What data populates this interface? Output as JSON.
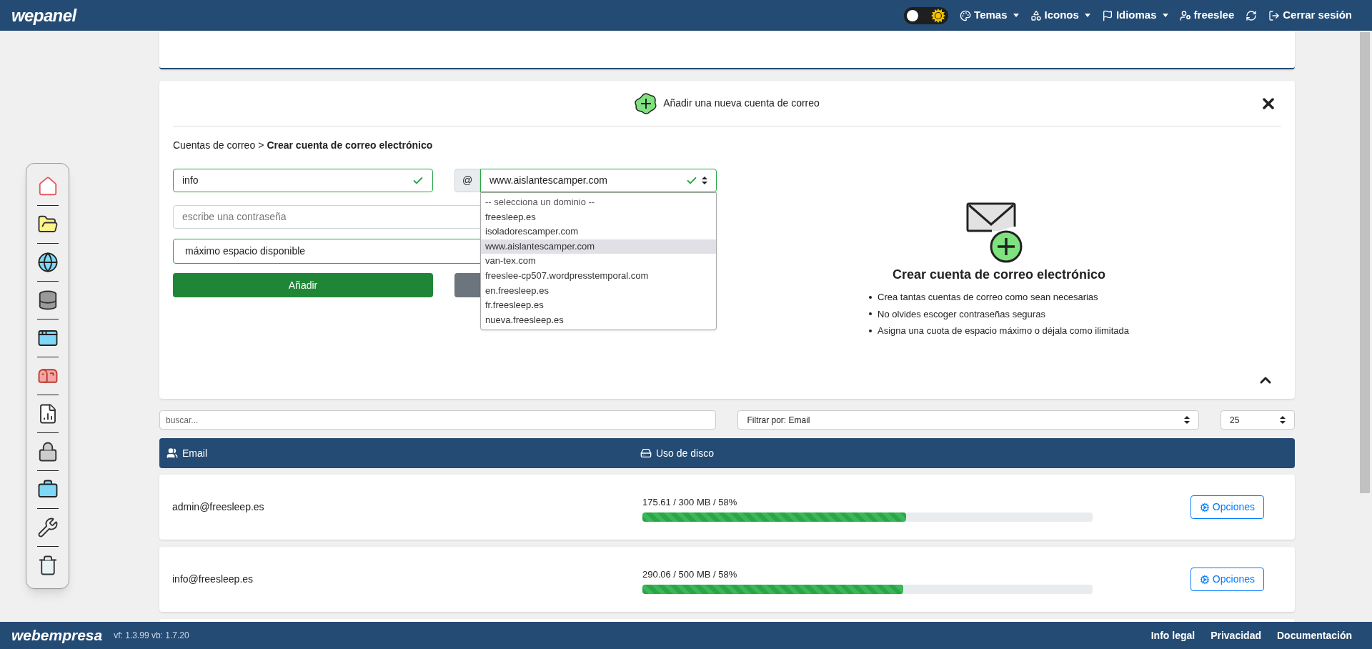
{
  "navbar": {
    "logo": "wepanel",
    "dark_mode": false,
    "items": [
      {
        "label": "Temas",
        "caret": true
      },
      {
        "label": "Iconos",
        "caret": true
      },
      {
        "label": "Idiomas",
        "caret": true
      },
      {
        "label": "freeslee",
        "caret": false
      }
    ],
    "logout": "Cerrar sesión"
  },
  "form_card": {
    "title": "Añadir una nueva cuenta de correo",
    "breadcrumb": {
      "parent": "Cuentas de correo",
      "separator": ">",
      "current": "Crear cuenta de correo electrónico"
    },
    "username": {
      "value": "info",
      "valid": true
    },
    "at_sign": "@",
    "domain": {
      "value": "www.aislantescamper.com",
      "valid": true,
      "expanded": true
    },
    "domain_options": [
      {
        "label": "-- selecciona un dominio --",
        "selected": false
      },
      {
        "label": "freesleep.es",
        "selected": false
      },
      {
        "label": "isoladorescamper.com",
        "selected": false
      },
      {
        "label": "www.aislantescamper.com",
        "selected": true
      },
      {
        "label": "van-tex.com",
        "selected": false
      },
      {
        "label": "freeslee-cp507.wordpresstemporal.com",
        "selected": false
      },
      {
        "label": "en.freesleep.es",
        "selected": false
      },
      {
        "label": "fr.freesleep.es",
        "selected": false
      },
      {
        "label": "nueva.freesleep.es",
        "selected": false
      }
    ],
    "password": {
      "placeholder": "escribe una contraseña",
      "valid": false
    },
    "quota": {
      "value": "máximo espacio disponible",
      "valid": true
    },
    "add_button": "Añadir",
    "info_title": "Crear cuenta de correo electrónico",
    "info_points": [
      "Crea tantas cuentas de correo como sean necesarias",
      "No olvides escoger contraseñas seguras",
      "Asigna una cuota de espacio máximo o déjala como ilimitada"
    ]
  },
  "filters": {
    "search_placeholder": "buscar...",
    "filter": "Filtrar por: Email",
    "per_page": "25"
  },
  "table": {
    "columns": [
      "Email",
      "Uso de disco"
    ],
    "rows": [
      {
        "email": "admin@freesleep.es",
        "usage": "175.61 / 300 MB / 58%",
        "level": 0.585,
        "action": "Opciones"
      },
      {
        "email": "info@freesleep.es",
        "usage": "290.06 / 500 MB / 58%",
        "level": 0.58,
        "action": "Opciones"
      }
    ]
  },
  "footer": {
    "logo": "webempresa",
    "version": "vf: 1.3.99 vb: 1.7.20",
    "links": [
      "Info legal",
      "Privacidad",
      "Documentación"
    ]
  }
}
